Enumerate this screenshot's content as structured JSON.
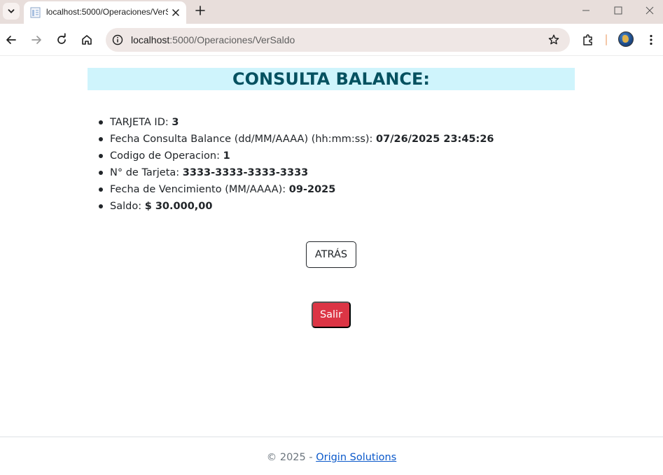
{
  "browser": {
    "tab_title": "localhost:5000/Operaciones/VerSaldo",
    "url_host": "localhost",
    "url_rest": ":5000/Operaciones/VerSaldo"
  },
  "page": {
    "heading": "CONSULTA BALANCE:",
    "details": [
      {
        "label": "TARJETA ID: ",
        "value": "3"
      },
      {
        "label": "Fecha Consulta Balance (dd/MM/AAAA) (hh:mm:ss): ",
        "value": "07/26/2025 23:45:26"
      },
      {
        "label": "Codigo de Operacion: ",
        "value": "1"
      },
      {
        "label": "N° de Tarjeta: ",
        "value": "3333-3333-3333-3333"
      },
      {
        "label": "Fecha de Vencimiento (MM/AAAA): ",
        "value": "09-2025"
      },
      {
        "label": "Saldo: ",
        "value": "$ 30.000,00"
      }
    ],
    "back_button": "ATRÁS",
    "exit_button": "Salir"
  },
  "footer": {
    "prefix": "© 2025 - ",
    "link": "Origin Solutions"
  },
  "colors": {
    "heading_bg": "#cff4fc",
    "heading_text": "#055160",
    "exit_button": "#dc3545",
    "link": "#0a58ca"
  }
}
